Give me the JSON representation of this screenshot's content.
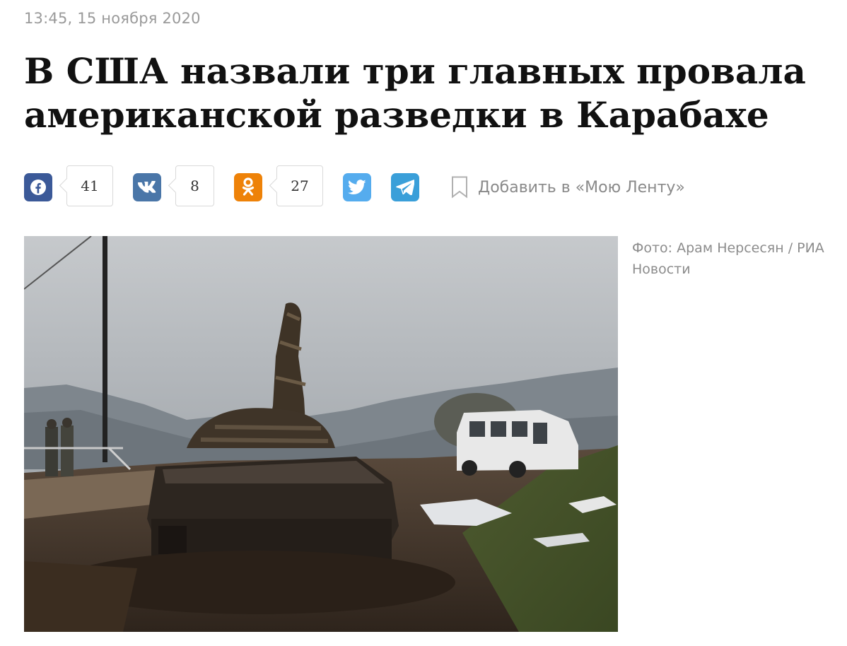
{
  "article": {
    "timestamp": "13:45, 15 ноября 2020",
    "title": "В США назвали три главных провала американской разведки в Карабахе"
  },
  "share": {
    "facebook": {
      "icon": "facebook-icon",
      "count": "41",
      "color": "#3b5998"
    },
    "vk": {
      "icon": "vk-icon",
      "count": "8",
      "color": "#4a76a8"
    },
    "ok": {
      "icon": "odnoklassniki-icon",
      "count": "27",
      "color": "#ee8208"
    },
    "twitter": {
      "icon": "twitter-icon",
      "color": "#55acee"
    },
    "telegram": {
      "icon": "telegram-icon",
      "color": "#3a9fd9"
    },
    "add_to_feed_label": "Добавить в «Мою Ленту»",
    "add_to_feed_icon": "bookmark-icon"
  },
  "photo": {
    "caption": "Фото: Арам Нерсесян / РИА Новости"
  }
}
